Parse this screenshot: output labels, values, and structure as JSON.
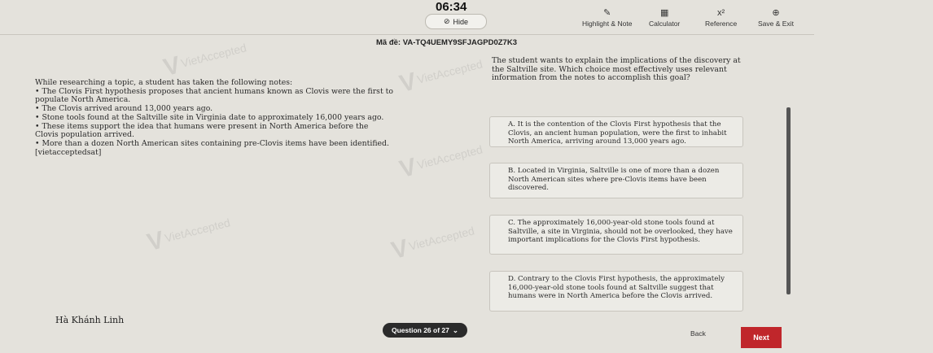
{
  "header": {
    "timer": "06:34",
    "hide_label": "Hide",
    "tools": [
      {
        "label": "Highlight & Note",
        "icon": "pencil-icon"
      },
      {
        "label": "Calculator",
        "icon": "calculator-icon"
      },
      {
        "label": "Reference",
        "icon": "formula-icon"
      },
      {
        "label": "Save & Exit",
        "icon": "exit-icon"
      }
    ],
    "exam_code": "Mã đề: VA-TQ4UEMY9SFJAGPD0Z7K3"
  },
  "passage": {
    "intro": "While researching a topic, a student has taken the following notes:",
    "notes": [
      "• The Clovis First hypothesis proposes that ancient humans known as Clovis were the first to populate North America.",
      "• The Clovis arrived around 13,000 years ago.",
      "• Stone tools found at the Saltville site in Virginia date to approximately 16,000 years ago.",
      "• These items support the idea that humans were present in North America before the Clovis population arrived.",
      "• More than a dozen North American sites containing pre-Clovis items have been identified."
    ],
    "source_tag": "[vietacceptedsat]"
  },
  "question": {
    "prompt": "The student wants to explain the implications of the discovery at the Saltville site. Which choice most effectively uses relevant information from the notes to accomplish this goal?",
    "options": [
      {
        "text": "A. It is the contention of the Clovis First hypothesis that the Clovis, an ancient human population, were the first to inhabit North America, arriving around 13,000 years ago."
      },
      {
        "text": "B. Located in Virginia, Saltville is one of more than a dozen North American sites where pre-Clovis items have been discovered."
      },
      {
        "text": "C. The approximately 16,000-year-old stone tools found at Saltville, a site in Virginia, should not be overlooked, they have important implications for the Clovis First hypothesis."
      },
      {
        "text": "D. Contrary to the Clovis First hypothesis, the approximately 16,000-year-old stone tools found at Saltville suggest that humans were in North America before the Clovis arrived."
      }
    ]
  },
  "footer": {
    "user_name": "Hà Khánh Linh",
    "question_nav": "Question 26 of 27",
    "back_label": "Back",
    "next_label": "Next"
  },
  "watermark": "VietAccepted",
  "colors": {
    "next_button": "#c0262b",
    "nav_pill": "#2b2b2b"
  }
}
